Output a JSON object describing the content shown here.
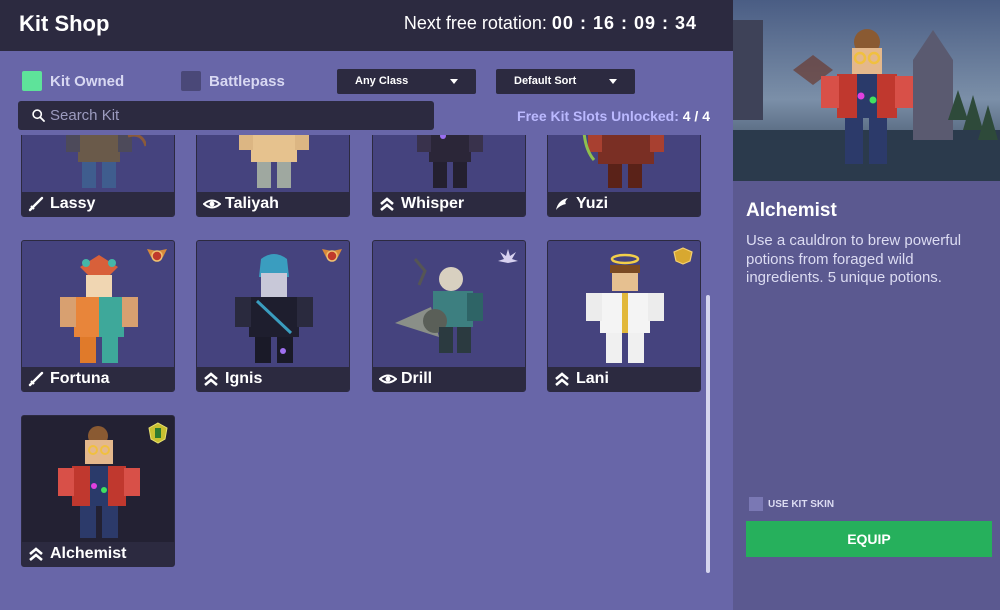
{
  "header": {
    "title": "Kit Shop",
    "rotation_label": "Next free rotation:",
    "rotation_time": "00 : 16 : 09 : 34"
  },
  "filters": {
    "kit_owned_label": "Kit Owned",
    "battlepass_label": "Battlepass",
    "class_dropdown": "Any Class",
    "sort_dropdown": "Default Sort"
  },
  "search": {
    "placeholder": "Search Kit"
  },
  "slots": {
    "label": "Free Kit Slots Unlocked:",
    "count": "4 / 4"
  },
  "kits": [
    {
      "name": "Lassy",
      "class_icon": "sword-icon",
      "rank_icon": ""
    },
    {
      "name": "Taliyah",
      "class_icon": "eye-icon",
      "rank_icon": ""
    },
    {
      "name": "Whisper",
      "class_icon": "chevron-up-icon",
      "rank_icon": ""
    },
    {
      "name": "Yuzi",
      "class_icon": "wing-icon",
      "rank_icon": ""
    },
    {
      "name": "Fortuna",
      "class_icon": "sword-icon",
      "rank_icon": "winged-badge-icon"
    },
    {
      "name": "Ignis",
      "class_icon": "chevron-up-icon",
      "rank_icon": "winged-badge-icon"
    },
    {
      "name": "Drill",
      "class_icon": "eye-icon",
      "rank_icon": "lotus-badge-icon"
    },
    {
      "name": "Lani",
      "class_icon": "chevron-up-icon",
      "rank_icon": "gold-badge-icon"
    },
    {
      "name": "Alchemist",
      "class_icon": "chevron-up-icon",
      "rank_icon": "green-badge-icon"
    }
  ],
  "selected": {
    "name": "Alchemist",
    "description": "Use a cauldron to brew powerful potions from foraged wild ingredients. 5 unique potions.",
    "use_skin_label": "USE KIT SKIN",
    "equip_label": "EQUIP"
  },
  "colors": {
    "accent_green": "#26b05c",
    "owned_green": "#5ee39a",
    "panel_purple": "#6866a8",
    "dark": "#2c2a40"
  }
}
